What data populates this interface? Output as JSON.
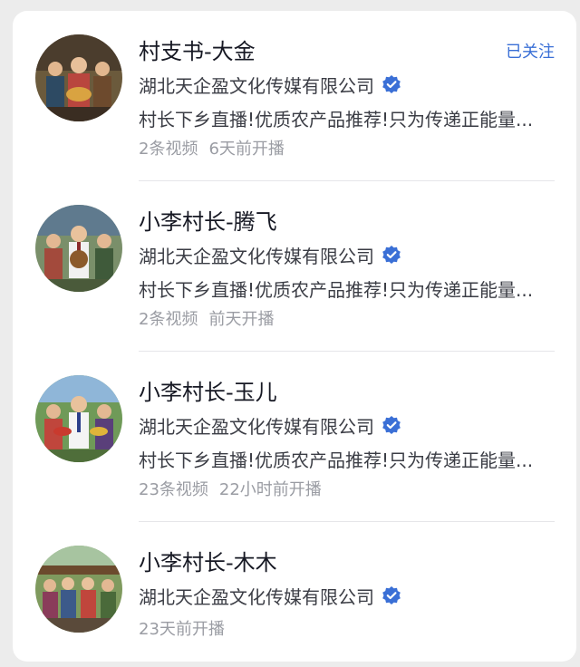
{
  "accounts": [
    {
      "name": "村支书-大金",
      "follow_label": "已关注",
      "company": "湖北天企盈文化传媒有限公司",
      "description": "村长下乡直播!优质农产品推荐!只为传递正能量...",
      "video_count": "2条视频",
      "live_time": "6天前开播"
    },
    {
      "name": "小李村长-腾飞",
      "company": "湖北天企盈文化传媒有限公司",
      "description": "村长下乡直播!优质农产品推荐!只为传递正能量...",
      "video_count": "2条视频",
      "live_time": "前天开播"
    },
    {
      "name": "小李村长-玉儿",
      "company": "湖北天企盈文化传媒有限公司",
      "description": "村长下乡直播!优质农产品推荐!只为传递正能量...",
      "video_count": "23条视频",
      "live_time": "22小时前开播"
    },
    {
      "name": "小李村长-木木",
      "company": "湖北天企盈文化传媒有限公司",
      "live_time": "23天前开播"
    }
  ],
  "colors": {
    "follow": "#3a6fd6",
    "verified_badge": "#3a6fd6",
    "muted_text": "#9a9ca3"
  },
  "icons": {
    "verified": "verified-badge-icon"
  }
}
